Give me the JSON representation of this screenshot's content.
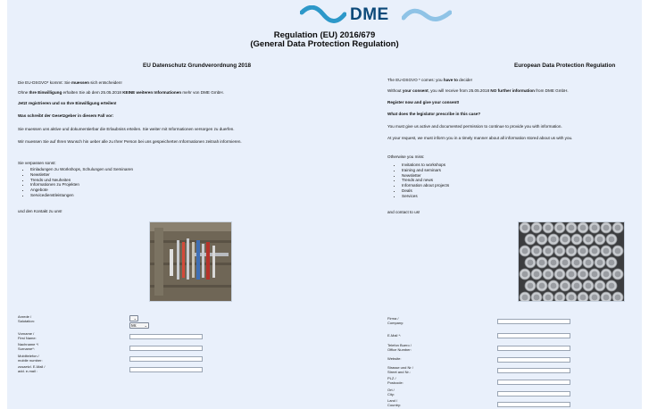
{
  "brand": {
    "logo_text": "DME",
    "wave_color": "#2d98c9",
    "text_color": "#0d4a7a"
  },
  "header": {
    "title_line1": "Regulation (EU) 2016/679",
    "title_line2": "(General Data Protection Regulation)"
  },
  "left": {
    "heading": "EU Datenschutz Grundverordnung 2018",
    "p1_a": "Die EU-DSGVO* kommt: Sie ",
    "p1_b": "muessen",
    "p1_c": " sich entscheiden!",
    "p2_a": "Ohne ",
    "p2_b": "Ihre Einwilligung",
    "p2_c": " erhalten Sie ab dem 25.05.2018 ",
    "p2_d": "KEINE weiteren Informationen",
    "p2_e": " mehr von DME GmbH.",
    "p3": "Jetzt registrieren und so Ihre Einwilligung erteilen!",
    "p4": "Was schreibt der Gesetzgeber in diesem Fall vor:",
    "p5": "Sie muessen uns aktive und dokumentierbar die Erlaubniss erteilen. Sie weiter mit Informationen versorgen zu duerfen.",
    "p6": "Wir muessen Sie auf Ihren Wunsch hin ueber alle zu Ihrer Person bei uns gespeicherten Informationen zeitnah informieren.",
    "miss_intro": "Sie verpassen sonst:",
    "bullets": [
      "Einladungen zu Workshops, Schulungen und Seminaren",
      "Newsletter",
      "Trends und Neuheiten",
      "Informationen zu Projekten",
      "Angebote",
      "Servicedienstleistungen"
    ],
    "closing": "und den Kontakt zu uns!"
  },
  "right": {
    "heading": "European Data Protection Regulation",
    "p1_a": "The EU-DSGVO * comes: you ",
    "p1_b": "have to",
    "p1_c": " decide!",
    "p2_a": "Without ",
    "p2_b": "your consent",
    "p2_c": ", you will receive from 25.05.2018 ",
    "p2_d": "NO further information",
    "p2_e": " from DME GmbH.",
    "p3": "Register now and give your consent!",
    "p4": "What does the legislator prescribe in this case?",
    "p5": "You must give us active and documented permission to continue to provide you with information.",
    "p6": "At your request, we must inform you in a timely manner about all information stored about us with you.",
    "miss_intro": "Otherwise you miss:",
    "bullets": [
      "Invitations to workshops",
      "training and seminars",
      "Newsletter",
      "Trends and news",
      "Information about projects",
      "Deals",
      "Services"
    ],
    "closing": "and contact to us!"
  },
  "form_left": {
    "anrede_label": "Anrede /\nSalutation:",
    "anrede_value": "",
    "salutation_value": "Mr.",
    "vorname_label": "Vorname /\nFirst Name:",
    "nachname_label": "Nachname */\nSurname*:",
    "mobil_label": "Mobiltelefon /\nmobile number:",
    "email2_label": "zusaetzl. E-Mail /\nadd. e-mail :"
  },
  "form_right": {
    "firma_label": "Firma /\nCompany:",
    "email_label": "E-Mail *:",
    "telefon_label": "Telefon Buero /\nOffice Number:",
    "website_label": "Website:",
    "strasse_label": "Strasse und Nr /\nStreet and Nr.:",
    "plz_label": "PLZ /\nPostcode:",
    "ort_label": "Ort /\nCity:",
    "land_label": "Land /\nCountry:"
  }
}
